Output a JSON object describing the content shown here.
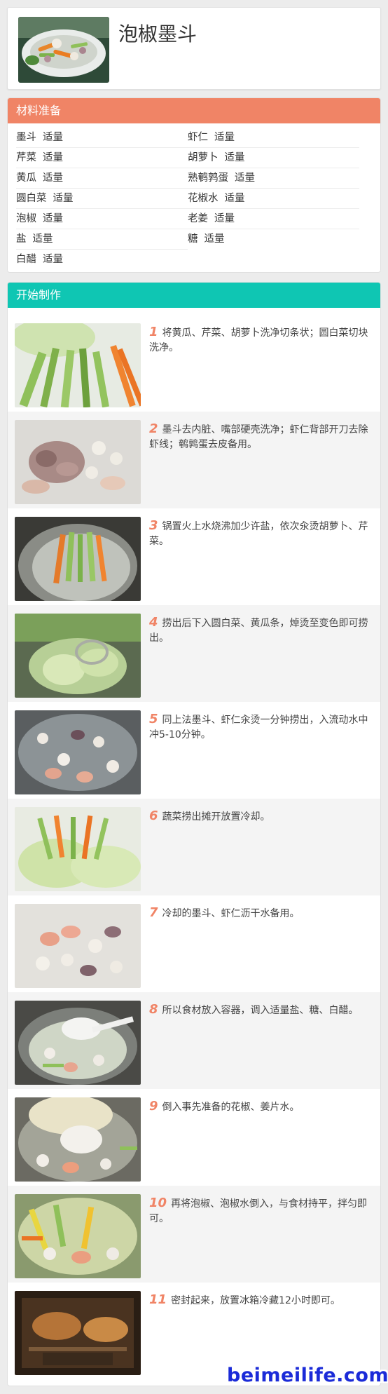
{
  "recipe": {
    "title": "泡椒墨斗"
  },
  "ingredients": {
    "header": "材料准备",
    "items": [
      {
        "name": "墨斗",
        "qty": "适量"
      },
      {
        "name": "虾仁",
        "qty": "适量"
      },
      {
        "name": "芹菜",
        "qty": "适量"
      },
      {
        "name": "胡萝卜",
        "qty": "适量"
      },
      {
        "name": "黄瓜",
        "qty": "适量"
      },
      {
        "name": "熟鹌鹑蛋",
        "qty": "适量"
      },
      {
        "name": "圆白菜",
        "qty": "适量"
      },
      {
        "name": "花椒水",
        "qty": "适量"
      },
      {
        "name": "泡椒",
        "qty": "适量"
      },
      {
        "name": "老姜",
        "qty": "适量"
      },
      {
        "name": "盐",
        "qty": "适量"
      },
      {
        "name": "糖",
        "qty": "适量"
      },
      {
        "name": "白醋",
        "qty": "适量"
      }
    ]
  },
  "steps": {
    "header": "开始制作",
    "items": [
      {
        "num": "1",
        "text": "将黄瓜、芹菜、胡萝卜洗净切条状；圆白菜切块洗净。"
      },
      {
        "num": "2",
        "text": "墨斗去内脏、嘴部硬壳洗净；虾仁背部开刀去除虾线；鹌鹑蛋去皮备用。"
      },
      {
        "num": "3",
        "text": "锅置火上水烧沸加少许盐，依次汆烫胡萝卜、芹菜。"
      },
      {
        "num": "4",
        "text": "捞出后下入圆白菜、黄瓜条，焯烫至变色即可捞出。"
      },
      {
        "num": "5",
        "text": "同上法墨斗、虾仁汆烫一分钟捞出，入流动水中冲5-10分钟。"
      },
      {
        "num": "6",
        "text": "蔬菜捞出摊开放置冷却。"
      },
      {
        "num": "7",
        "text": "冷却的墨斗、虾仁沥干水备用。"
      },
      {
        "num": "8",
        "text": "所以食材放入容器，调入适量盐、糖、白醋。"
      },
      {
        "num": "9",
        "text": "倒入事先准备的花椒、姜片水。"
      },
      {
        "num": "10",
        "text": "再将泡椒、泡椒水倒入，与食材持平，拌匀即可。"
      },
      {
        "num": "11",
        "text": "密封起来，放置冰箱冷藏12小时即可。"
      }
    ]
  },
  "watermark": {
    "text": "beimeilife.com"
  }
}
